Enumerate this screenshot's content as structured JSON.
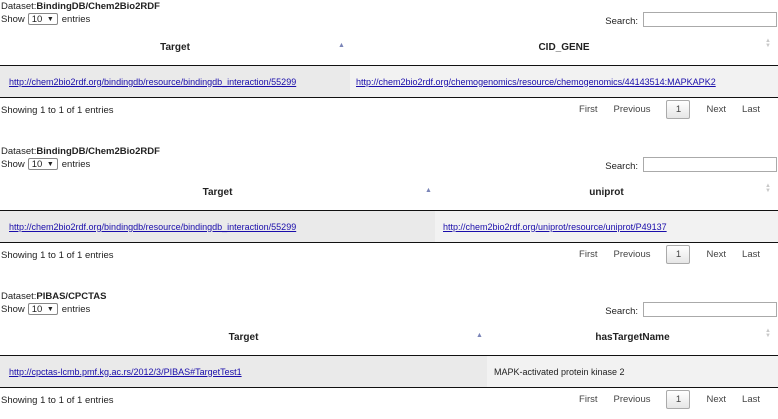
{
  "ui": {
    "dataset_prefix": "Dataset:",
    "show_label": "Show",
    "entries_label": "entries",
    "search_label": "Search:",
    "pagination": {
      "first": "First",
      "previous": "Previous",
      "page": "1",
      "next": "Next",
      "last": "Last"
    }
  },
  "tables": [
    {
      "dataset": "BindingDB/Chem2Bio2RDF",
      "length": "10",
      "columns": [
        "Target",
        "CID_GENE"
      ],
      "row": [
        "http://chem2bio2rdf.org/bindingdb/resource/bindingdb_interaction/55299",
        "http://chem2bio2rdf.org/chemogenomics/resource/chemogenomics/44143514:MAPKAPK2"
      ],
      "info": "Showing 1 to 1 of 1 entries"
    },
    {
      "dataset": "BindingDB/Chem2Bio2RDF",
      "length": "10",
      "columns": [
        "Target",
        "uniprot"
      ],
      "row": [
        "http://chem2bio2rdf.org/bindingdb/resource/bindingdb_interaction/55299",
        "http://chem2bio2rdf.org/uniprot/resource/uniprot/P49137"
      ],
      "info": "Showing 1 to 1 of 1 entries"
    },
    {
      "dataset": "PIBAS/CPCTAS",
      "length": "10",
      "columns": [
        "Target",
        "hasTargetName"
      ],
      "row": [
        "http://cpctas-lcmb.pmf.kg.ac.rs/2012/3/PIBAS#TargetTest1",
        "MAPK-activated protein kinase 2"
      ],
      "info": "Showing 1 to 1 of 1 entries"
    }
  ]
}
